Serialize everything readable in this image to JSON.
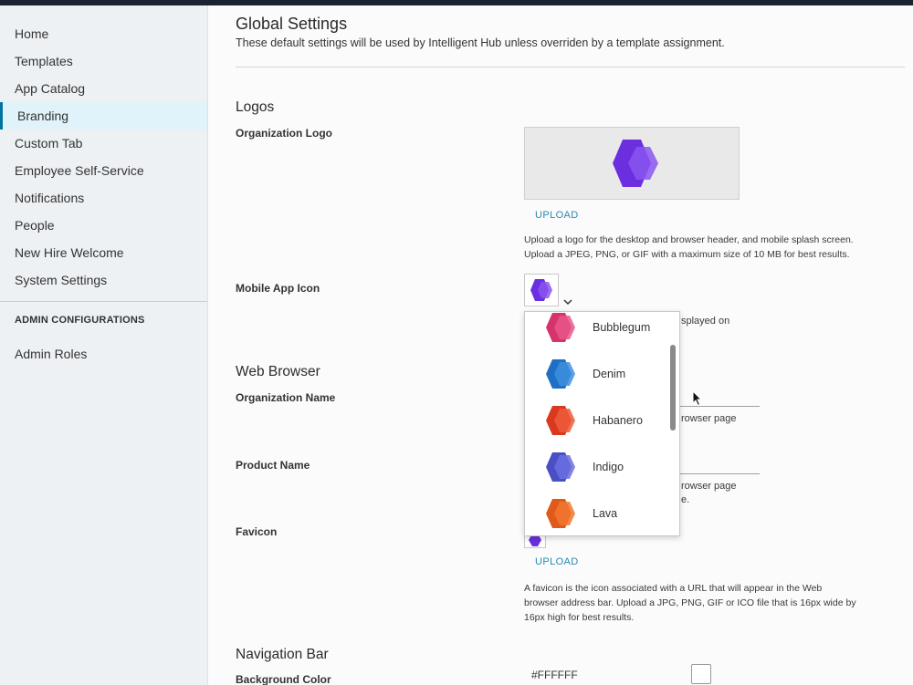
{
  "sidebar": {
    "items": [
      {
        "label": "Home"
      },
      {
        "label": "Templates"
      },
      {
        "label": "App Catalog"
      },
      {
        "label": "Branding"
      },
      {
        "label": "Custom Tab"
      },
      {
        "label": "Employee Self-Service"
      },
      {
        "label": "Notifications"
      },
      {
        "label": "People"
      },
      {
        "label": "New Hire Welcome"
      },
      {
        "label": "System Settings"
      }
    ],
    "active_item": "Branding",
    "admin_header": "ADMIN CONFIGURATIONS",
    "admin_items": [
      {
        "label": "Admin Roles"
      }
    ]
  },
  "main": {
    "title": "Global Settings",
    "subtitle": "These default settings will be used by Intelligent Hub unless overriden by a template assignment.",
    "logos": {
      "section_title": "Logos",
      "org_logo_label": "Organization Logo",
      "upload_label": "UPLOAD",
      "org_logo_help_1": "Upload a logo for the desktop and browser header, and mobile splash screen.",
      "org_logo_help_2": "Upload a JPEG, PNG, or GIF with a maximum size of 10 MB for best results.",
      "mobile_icon_label": "Mobile App Icon",
      "mobile_icon_help_partial": "splayed on"
    },
    "web_browser": {
      "section_title": "Web Browser",
      "org_name_label": "Organization Name",
      "org_name_help_partial": "rowser page",
      "product_name_label": "Product Name",
      "product_name_help_partial_1": "rowser page",
      "product_name_help_partial_2": "e.",
      "favicon_label": "Favicon",
      "favicon_upload_label": "UPLOAD",
      "favicon_help_1": "A favicon is the icon associated with a URL that will appear in the Web",
      "favicon_help_2": "browser address bar. Upload a JPG, PNG, GIF or ICO file that is 16px wide by",
      "favicon_help_3": "16px high for best results."
    },
    "navigation_bar": {
      "section_title": "Navigation Bar",
      "bg_color_label": "Background Color",
      "bg_color_value": "#FFFFFF"
    }
  },
  "icon_dropdown": {
    "options": [
      {
        "label": "Bubblegum",
        "color": "#d6336c",
        "color2": "#e8578a"
      },
      {
        "label": "Denim",
        "color": "#1f6fc4",
        "color2": "#3f8fe0"
      },
      {
        "label": "Habanero",
        "color": "#d93a1f",
        "color2": "#ef5a3a"
      },
      {
        "label": "Indigo",
        "color": "#4b4fc4",
        "color2": "#6a6ee0"
      },
      {
        "label": "Lava",
        "color": "#e05a1c",
        "color2": "#f2772f"
      }
    ],
    "selected_icon_color": "#6b2fe0"
  },
  "colors": {
    "accent": "#0072a3",
    "link": "#2a8ab0",
    "brand_purple": "#6b2fe0"
  }
}
